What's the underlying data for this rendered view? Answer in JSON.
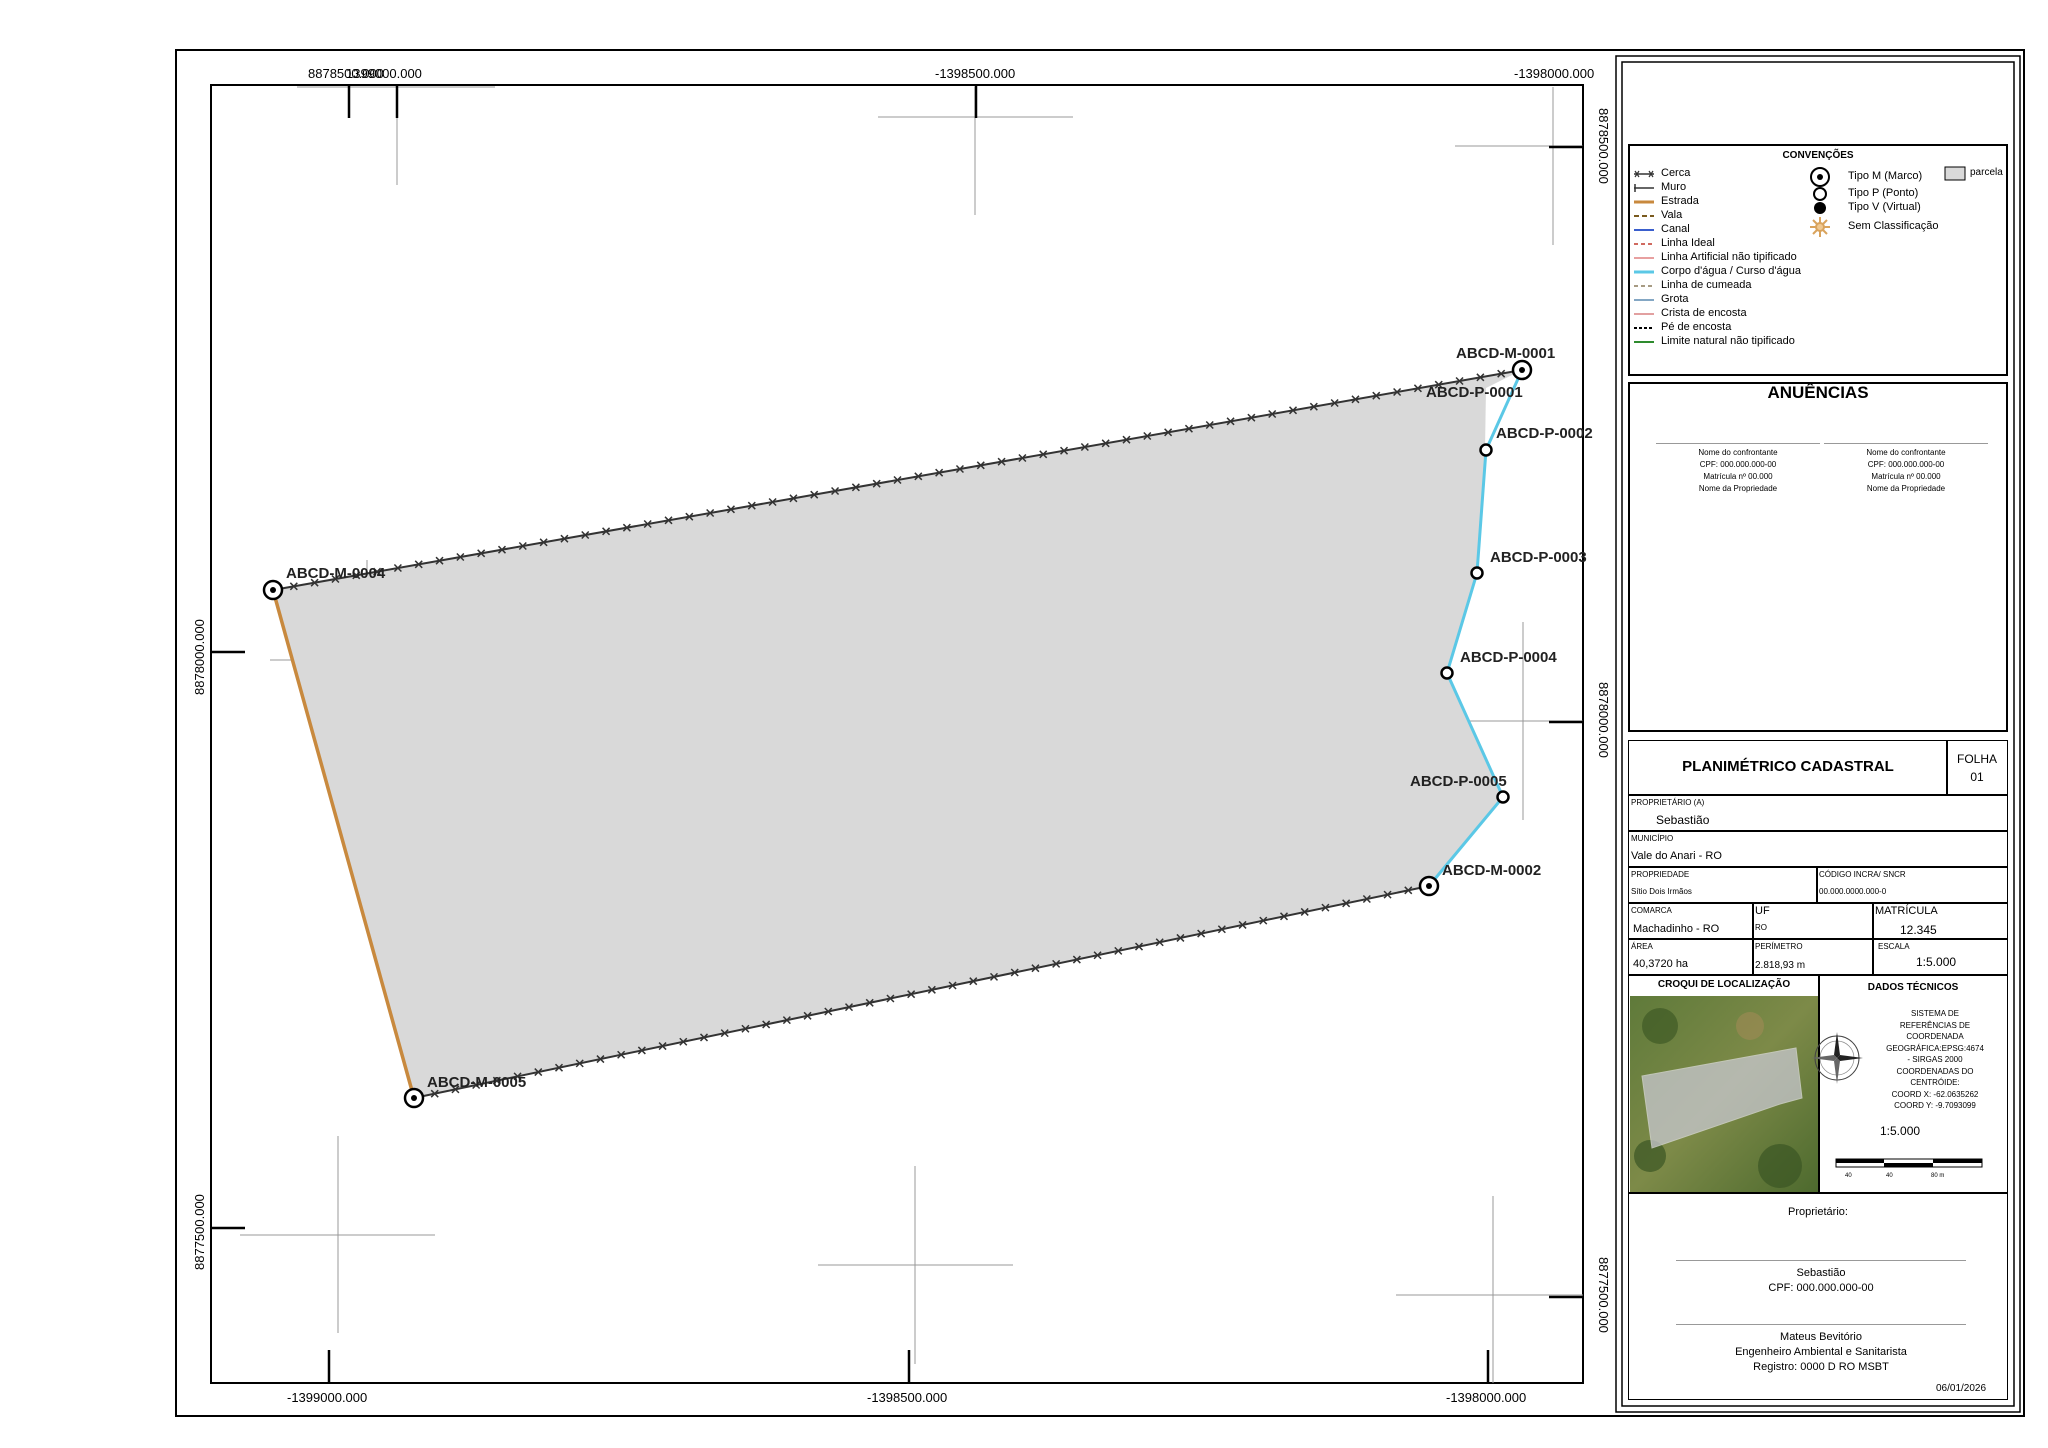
{
  "grid_labels": {
    "top": [
      "8878500.000",
      "1399000.000",
      "-1398500.000",
      "-1398000.000"
    ],
    "bottom": [
      "-1399000.000",
      "-1398500.000",
      "-1398000.000"
    ],
    "left": [
      "8878000.000",
      "8877500.000"
    ],
    "right": [
      "8878500.000",
      "8878000.000",
      "8877500.000"
    ]
  },
  "vertices": [
    {
      "label": "ABCD-M-0001",
      "type": "M"
    },
    {
      "label": "ABCD-P-0001",
      "type": "P"
    },
    {
      "label": "ABCD-P-0002",
      "type": "P"
    },
    {
      "label": "ABCD-P-0003",
      "type": "P"
    },
    {
      "label": "ABCD-P-0004",
      "type": "P"
    },
    {
      "label": "ABCD-P-0005",
      "type": "P"
    },
    {
      "label": "ABCD-M-0002",
      "type": "M"
    },
    {
      "label": "ABCD-M-0005",
      "type": "M"
    },
    {
      "label": "ABCD-M-0004",
      "type": "M"
    }
  ],
  "colors": {
    "parcel_fill": "#d9d9d9",
    "road": "#c8893e",
    "water": "#5bc8e6",
    "fence": "#333333"
  },
  "legend": {
    "title": "CONVENÇÕES",
    "lines": [
      "Cerca",
      "Muro",
      "Estrada",
      "Vala",
      "Canal",
      "Linha Ideal",
      "Linha Artificial não tipificado",
      "Corpo d'água / Curso d'água",
      "Linha de cumeada",
      "Grota",
      "Crista de encosta",
      "Pé de encosta",
      "Limite natural não tipificado"
    ],
    "points": [
      "Tipo M (Marco)",
      "Tipo P (Ponto)",
      "Tipo V (Virtual)",
      "Sem Classificação"
    ],
    "parcel": "parcela"
  },
  "anuencias": {
    "title": "ANUÊNCIAS",
    "signatories": [
      {
        "name": "Nome do confrontante",
        "cpf": "CPF: 000.000.000-00",
        "matricula": "Matrícula nº 00.000",
        "propriedade": "Nome da Propriedade"
      },
      {
        "name": "Nome do confrontante",
        "cpf": "CPF: 000.000.000-00",
        "matricula": "Matrícula nº 00.000",
        "propriedade": "Nome da Propriedade"
      }
    ]
  },
  "title_block": {
    "title": "PLANIMÉTRICO CADASTRAL",
    "folha_label": "FOLHA",
    "folha_value": "01",
    "proprietario_label": "PROPRIETÁRIO (A)",
    "proprietario_value": "Sebastião",
    "municipio_label": "MUNICÍPIO",
    "municipio_value": "Vale do Anari - RO",
    "propriedade_label": "PROPRIEDADE",
    "propriedade_value": "Sítio Dois Irmãos",
    "incra_label": "CÓDIGO INCRA/ SNCR",
    "incra_value": "00.000.0000.000-0",
    "comarca_label": "COMARCA",
    "comarca_value": "Machadinho - RO",
    "uf_label": "UF",
    "uf_value": "RO",
    "matricula_label": "MATRÍCULA",
    "matricula_value": "12.345",
    "area_label": "ÁREA",
    "area_value": "40,3720 ha",
    "perimetro_label": "PERÍMETRO",
    "perimetro_value": "2.818,93 m",
    "escala_label": "ESCALA",
    "escala_value": "1:5.000"
  },
  "croqui": {
    "title": "CROQUI DE LOCALIZAÇÃO"
  },
  "dados_tecnicos": {
    "title": "DADOS TÉCNICOS",
    "lines": [
      "SISTEMA DE",
      "REFERÊNCIAS DE",
      "COORDENADA",
      "GEOGRÁFICA:EPSG:4674",
      "- SIRGAS 2000",
      "COORDENADAS DO",
      "CENTRÓIDE:",
      "COORD X: -62.0635262",
      "COORD Y: -9.7093099"
    ],
    "scale": "1:5.000",
    "scalebar_labels": [
      "40",
      "40",
      "80 m"
    ]
  },
  "signatures": {
    "owner_heading": "Proprietário:",
    "owner_name": "Sebastião",
    "owner_cpf": "CPF: 000.000.000-00",
    "engineer_name": "Mateus Bevitório",
    "engineer_title": "Engenheiro Ambiental e Sanitarista",
    "engineer_registry": "Registro:  0000 D RO MSBT",
    "date": "06/01/2026"
  }
}
